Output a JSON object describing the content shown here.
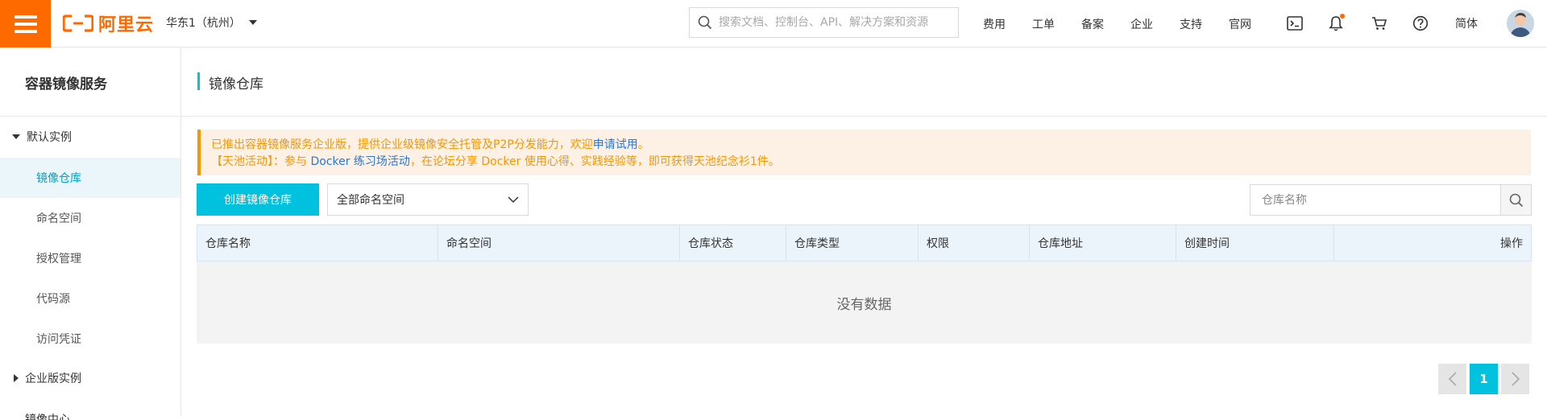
{
  "header": {
    "logo_text": "阿里云",
    "region": "华东1（杭州）",
    "search_placeholder": "搜索文档、控制台、API、解决方案和资源",
    "nav": [
      "费用",
      "工单",
      "备案",
      "企业",
      "支持",
      "官网"
    ],
    "icons": [
      "terminal-icon",
      "bell-icon",
      "cart-icon",
      "help-icon"
    ],
    "language": "简体",
    "brand_color": "#ff6a00"
  },
  "sidebar": {
    "title": "容器镜像服务",
    "groups": [
      {
        "label": "默认实例",
        "expanded": true
      },
      {
        "label": "企业版实例",
        "expanded": false
      },
      {
        "label": "镜像中心",
        "expanded": false
      }
    ],
    "items": [
      {
        "label": "镜像仓库",
        "active": true
      },
      {
        "label": "命名空间",
        "active": false
      },
      {
        "label": "授权管理",
        "active": false
      },
      {
        "label": "代码源",
        "active": false
      },
      {
        "label": "访问凭证",
        "active": false
      }
    ]
  },
  "page": {
    "title": "镜像仓库",
    "notice": {
      "line1_text": "已推出容器镜像服务企业版，提供企业级镜像安全托管及P2P分发能力，欢迎",
      "line1_link": "申请试用",
      "line1_end": "。",
      "line2_prefix": "【天池活动】：参与 ",
      "line2_link": "Docker 练习场活动",
      "line2_suffix": "，在论坛分享 Docker 使用心得、实践经验等，即可获得天池纪念衫1件。"
    },
    "create_button": "创建镜像仓库",
    "namespace_select": "全部命名空间",
    "repo_search_placeholder": "仓库名称",
    "table": {
      "columns": [
        "仓库名称",
        "命名空间",
        "仓库状态",
        "仓库类型",
        "权限",
        "仓库地址",
        "创建时间",
        "操作"
      ],
      "empty_text": "没有数据"
    },
    "pagination": {
      "current": "1"
    },
    "accent_color": "#00c1de",
    "notice_color": "#f39800"
  }
}
